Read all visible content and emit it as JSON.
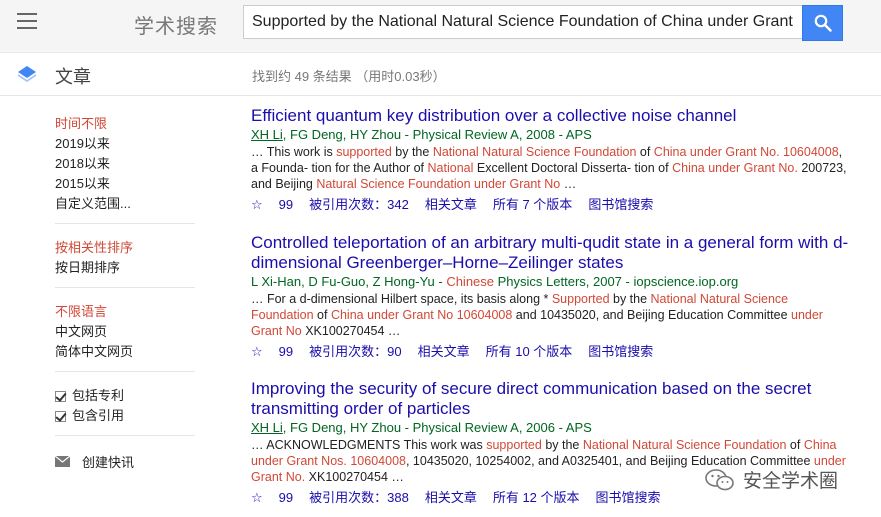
{
  "header": {
    "logo": "学术搜索",
    "search_value": "Supported by the National Natural Science Foundation of China under Grant"
  },
  "subheader": {
    "section": "文章",
    "stats": "找到约 49 条结果 （用时0.03秒）"
  },
  "sidebar": {
    "time": [
      "时间不限",
      "2019以来",
      "2018以来",
      "2015以来",
      "自定义范围..."
    ],
    "sort": [
      "按相关性排序",
      "按日期排序"
    ],
    "lang": [
      "不限语言",
      "中文网页",
      "简体中文网页"
    ],
    "include_patents": "包括专利",
    "include_citations": "包含引用",
    "create_alert": "创建快讯"
  },
  "results": [
    {
      "title": "Efficient quantum key distribution over a collective noise channel",
      "author_link": "XH Li",
      "meta": ", FG Deng, HY Zhou - Physical Review A, 2008 - APS",
      "snippet": [
        {
          "t": "… This work is ",
          "h": false
        },
        {
          "t": "supported",
          "h": true
        },
        {
          "t": " by the ",
          "h": false
        },
        {
          "t": "National Natural Science Foundation",
          "h": true
        },
        {
          "t": " of ",
          "h": false
        },
        {
          "t": "China under Grant No. 10604008",
          "h": true
        },
        {
          "t": ", a Founda- tion for the Author of ",
          "h": false
        },
        {
          "t": "National",
          "h": true
        },
        {
          "t": " Excellent Doctoral Disserta- tion of ",
          "h": false
        },
        {
          "t": "China under Grant No.",
          "h": true
        },
        {
          "t": " 200723, and Beijing ",
          "h": false
        },
        {
          "t": "Natural Science Foundation under Grant No",
          "h": true
        },
        {
          "t": " …",
          "h": false
        }
      ],
      "star": "☆",
      "cite": "99",
      "cited_by": "被引用次数：342",
      "related": "相关文章",
      "versions": "所有 7 个版本",
      "library": "图书馆搜索"
    },
    {
      "title": "Controlled teleportation of an arbitrary multi-qudit state in a general form with d-dimensional Greenberger–Horne–Zeilinger states",
      "author_link": "",
      "meta": "L Xi-Han, D Fu-Guo, Z Hong-Yu - ",
      "meta_hl": "Chinese",
      "meta_tail": " Physics Letters, 2007 - iopscience.iop.org",
      "snippet": [
        {
          "t": "… For a d-dimensional Hilbert space, its basis along * ",
          "h": false
        },
        {
          "t": "Supported",
          "h": true
        },
        {
          "t": " by the ",
          "h": false
        },
        {
          "t": "National Natural Science Foundation",
          "h": true
        },
        {
          "t": " of ",
          "h": false
        },
        {
          "t": "China under Grant No 10604008",
          "h": true
        },
        {
          "t": " and 10435020, and Beijing Education Committee ",
          "h": false
        },
        {
          "t": "under Grant No",
          "h": true
        },
        {
          "t": " XK100270454 …",
          "h": false
        }
      ],
      "star": "☆",
      "cite": "99",
      "cited_by": "被引用次数：90",
      "related": "相关文章",
      "versions": "所有 10 个版本",
      "library": "图书馆搜索"
    },
    {
      "title": "Improving the security of secure direct communication based on the secret transmitting order of particles",
      "author_link": "XH Li",
      "meta": ", FG Deng, HY Zhou - Physical Review A, 2006 - APS",
      "snippet": [
        {
          "t": "… ACKNOWLEDGMENTS This work was ",
          "h": false
        },
        {
          "t": "supported",
          "h": true
        },
        {
          "t": " by the ",
          "h": false
        },
        {
          "t": "National Natural Science Foundation",
          "h": true
        },
        {
          "t": " of ",
          "h": false
        },
        {
          "t": "China under Grant Nos. 10604008",
          "h": true
        },
        {
          "t": ", 10435020, 10254002, and A0325401, and Beijing Education Committee ",
          "h": false
        },
        {
          "t": "under Grant No.",
          "h": true
        },
        {
          "t": " XK100270454 …",
          "h": false
        }
      ],
      "star": "☆",
      "cite": "99",
      "cited_by": "被引用次数：388",
      "related": "相关文章",
      "versions": "所有 12 个版本",
      "library": "图书馆搜索"
    }
  ],
  "watermark": "安全学术圈",
  "colors": {
    "accent": "#4285f4",
    "link": "#1a0dab",
    "highlight": "#d14836",
    "source": "#006621"
  }
}
